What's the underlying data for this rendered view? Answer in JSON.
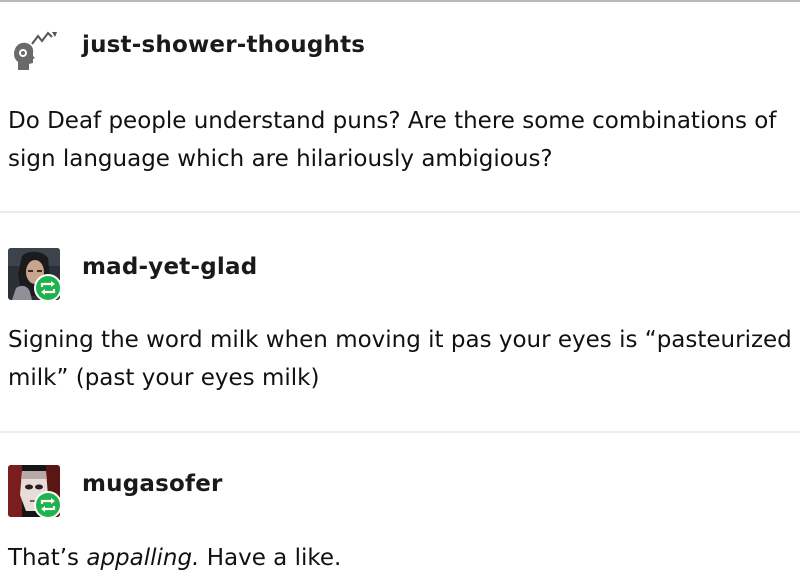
{
  "posts": [
    {
      "username": "just-shower-thoughts",
      "avatar_icon": "lightbulb-head-icon",
      "reblogged": false,
      "body": "Do Deaf people understand puns? Are there some combinations of sign language which are hilariously ambigious?"
    },
    {
      "username": "mad-yet-glad",
      "avatar_icon": "user-photo-avatar",
      "reblogged": true,
      "body": "Signing the word milk when moving it pas your eyes is “pasteurized milk” (past your eyes milk)"
    },
    {
      "username": "mugasofer",
      "avatar_icon": "mask-avatar",
      "reblogged": true,
      "body_before": "That’s ",
      "body_emphasis": "appalling.",
      "body_after": " Have a like."
    }
  ],
  "colors": {
    "reblog_green": "#1fb34d",
    "text": "#111111",
    "divider": "#ececec"
  }
}
